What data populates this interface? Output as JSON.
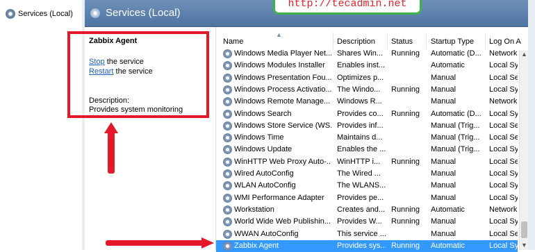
{
  "tree": {
    "item_label": "Services (Local)"
  },
  "header": {
    "title": "Services (Local)"
  },
  "watermark": {
    "url": "http://tecadmin.net"
  },
  "details": {
    "service_name": "Zabbix Agent",
    "stop_link": "Stop",
    "stop_rest": " the service",
    "restart_link": "Restart",
    "restart_rest": " the service",
    "description_label": "Description:",
    "description_text": "Provides system monitoring"
  },
  "columns": {
    "name": "Name",
    "description": "Description",
    "status": "Status",
    "startup_type": "Startup Type",
    "log_on_as": "Log On A"
  },
  "services": [
    {
      "name": "Windows Media Player Net...",
      "description": "Shares Win...",
      "status": "Running",
      "startup": "Automatic (D...",
      "logon": "Network"
    },
    {
      "name": "Windows Modules Installer",
      "description": "Enables inst...",
      "status": "",
      "startup": "Automatic",
      "logon": "Local Sys"
    },
    {
      "name": "Windows Presentation Fou...",
      "description": "Optimizes p...",
      "status": "",
      "startup": "Manual",
      "logon": "Local Ser"
    },
    {
      "name": "Windows Process Activatio...",
      "description": "The Windo...",
      "status": "Running",
      "startup": "Manual",
      "logon": "Local Sys"
    },
    {
      "name": "Windows Remote Manage...",
      "description": "Windows R...",
      "status": "",
      "startup": "Manual",
      "logon": "Network"
    },
    {
      "name": "Windows Search",
      "description": "Provides co...",
      "status": "Running",
      "startup": "Automatic (D...",
      "logon": "Local Sys"
    },
    {
      "name": "Windows Store Service (WS...",
      "description": "Provides inf...",
      "status": "",
      "startup": "Manual (Trig...",
      "logon": "Local Ser"
    },
    {
      "name": "Windows Time",
      "description": "Maintains d...",
      "status": "",
      "startup": "Manual (Trig...",
      "logon": "Local Ser"
    },
    {
      "name": "Windows Update",
      "description": "Enables the ...",
      "status": "",
      "startup": "Manual (Trig...",
      "logon": "Local Sys"
    },
    {
      "name": "WinHTTP Web Proxy Auto-...",
      "description": "WinHTTP i...",
      "status": "Running",
      "startup": "Manual",
      "logon": "Local Ser"
    },
    {
      "name": "Wired AutoConfig",
      "description": "The Wired ...",
      "status": "",
      "startup": "Manual",
      "logon": "Local Sys"
    },
    {
      "name": "WLAN AutoConfig",
      "description": "The WLANS...",
      "status": "",
      "startup": "Manual",
      "logon": "Local Sys"
    },
    {
      "name": "WMI Performance Adapter",
      "description": "Provides pe...",
      "status": "",
      "startup": "Manual",
      "logon": "Local Sys"
    },
    {
      "name": "Workstation",
      "description": "Creates and...",
      "status": "Running",
      "startup": "Automatic",
      "logon": "Network"
    },
    {
      "name": "World Wide Web Publishin...",
      "description": "Provides W...",
      "status": "Running",
      "startup": "Manual",
      "logon": "Local Sys"
    },
    {
      "name": "WWAN AutoConfig",
      "description": "This service ...",
      "status": "",
      "startup": "Manual",
      "logon": "Local Ser"
    },
    {
      "name": "Zabbix Agent",
      "description": "Provides sys...",
      "status": "Running",
      "startup": "Automatic",
      "logon": "Local Sys",
      "selected": true
    }
  ],
  "colors": {
    "selection": "#3399ff",
    "annotation_red": "#e3192a",
    "watermark_green": "#3db24a",
    "link": "#1a5fb4"
  }
}
